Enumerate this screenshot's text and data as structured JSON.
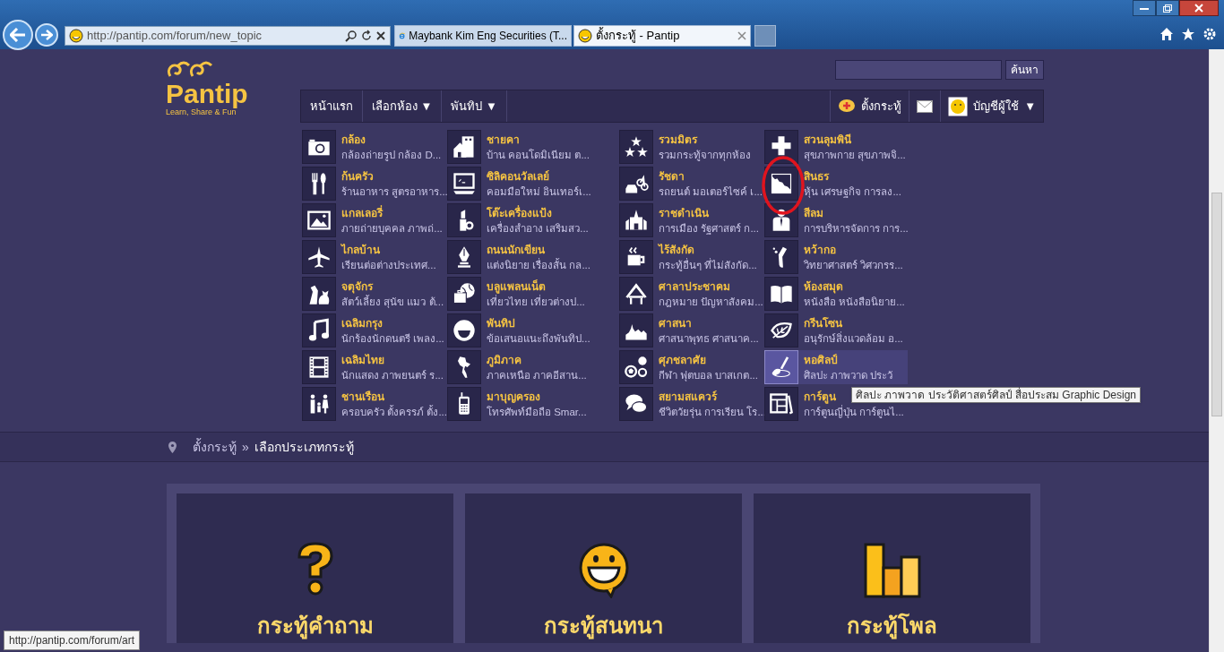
{
  "browser": {
    "address": "http://pantip.com/forum/new_topic",
    "tabs": [
      {
        "title": "Maybank Kim Eng Securities (T...",
        "selected": false,
        "kind": "ie"
      },
      {
        "title": "ตั้งกระทู้ - Pantip",
        "selected": true,
        "kind": "pantip"
      }
    ],
    "status_url": "http://pantip.com/forum/art"
  },
  "header": {
    "logo": "Pantip",
    "tagline": "Learn, Share & Fun",
    "search_button": "ค้นหา",
    "nav": [
      {
        "label": "หน้าแรก"
      },
      {
        "label": "เลือกห้อง",
        "caret": "▼"
      },
      {
        "label": "พันทิป",
        "caret": "▼"
      }
    ],
    "new_topic": "ตั้งกระทู้",
    "account": "บัญชีผู้ใช้",
    "account_caret": "▼"
  },
  "categories": [
    [
      {
        "title": "กล้อง",
        "description": "กล้องถ่ายรูป กล้อง D...",
        "highlighted": false
      },
      {
        "title": "ก้นครัว",
        "description": "ร้านอาหาร สูตรอาหาร...",
        "highlighted": false
      },
      {
        "title": "แกลเลอรี่",
        "description": "ภายถ่ายบุคคล ภาพถ่...",
        "highlighted": false
      },
      {
        "title": "ไกลบ้าน",
        "description": "เรียนต่อต่างประเทศ...",
        "highlighted": false
      },
      {
        "title": "จตุจักร",
        "description": "สัตว์เลี้ยง สุนัข แมว ต้...",
        "highlighted": false
      },
      {
        "title": "เฉลิมกรุง",
        "description": "นักร้องนักดนตรี เพลง...",
        "highlighted": false
      },
      {
        "title": "เฉลิมไทย",
        "description": "นักแสดง ภาพยนตร์ ร...",
        "highlighted": false
      },
      {
        "title": "ชานเรือน",
        "description": "ครอบครัว ตั้งครรภ์ ตั้ง...",
        "highlighted": false
      }
    ],
    [
      {
        "title": "ชายคา",
        "description": "บ้าน คอนโดมิเนียม ต...",
        "highlighted": false
      },
      {
        "title": "ซิลิคอนวัลเลย์",
        "description": "คอมมือใหม่ อินเทอร์เ...",
        "highlighted": false
      },
      {
        "title": "โต๊ะเครื่องแป้ง",
        "description": "เครื่องสำอาง เสริมสว...",
        "highlighted": false
      },
      {
        "title": "ถนนนักเขียน",
        "description": "แต่งนิยาย เรื่องสั้น กล...",
        "highlighted": false
      },
      {
        "title": "บลูแพลนเน็ต",
        "description": "เที่ยวไทย เที่ยวต่างป...",
        "highlighted": false
      },
      {
        "title": "พันทิป",
        "description": "ข้อเสนอแนะถึงพันทิป...",
        "highlighted": false
      },
      {
        "title": "ภูมิภาค",
        "description": "ภาคเหนือ ภาคอีสาน...",
        "highlighted": false
      },
      {
        "title": "มาบุญครอง",
        "description": "โทรศัพท์มือถือ Smar...",
        "highlighted": false
      }
    ],
    [
      {
        "title": "รวมมิตร",
        "description": "รวมกระทู้จากทุกห้อง",
        "highlighted": false
      },
      {
        "title": "รัชดา",
        "description": "รถยนต์ มอเตอร์ไซค์ เ...",
        "highlighted": false
      },
      {
        "title": "ราชดำเนิน",
        "description": "การเมือง รัฐศาสตร์ ก...",
        "highlighted": false
      },
      {
        "title": "ไร้สังกัด",
        "description": "กระทู้อื่นๆ ที่ไม่สังกัด...",
        "highlighted": false
      },
      {
        "title": "ศาลาประชาคม",
        "description": "กฎหมาย ปัญหาสังคม...",
        "highlighted": false
      },
      {
        "title": "ศาสนา",
        "description": "ศาสนาพุทธ ศาสนาค...",
        "highlighted": false
      },
      {
        "title": "ศุภชลาศัย",
        "description": "กีฬา ฟุตบอล บาสเกต...",
        "highlighted": false
      },
      {
        "title": "สยามสแควร์",
        "description": "ชีวิตวัยรุ่น การเรียน โร...",
        "highlighted": false
      }
    ],
    [
      {
        "title": "สวนลุมพินี",
        "description": "สุขภาพกาย สุขภาพจิ...",
        "highlighted": false
      },
      {
        "title": "สินธร",
        "description": "หุ้น เศรษฐกิจ การลง...",
        "highlighted": false
      },
      {
        "title": "สีลม",
        "description": "การบริหารจัดการ การ...",
        "highlighted": false
      },
      {
        "title": "หว้ากอ",
        "description": "วิทยาศาสตร์ วิศวกรร...",
        "highlighted": false
      },
      {
        "title": "ห้องสมุด",
        "description": "หนังสือ หนังสือนิยาย...",
        "highlighted": false
      },
      {
        "title": "กรีนโซน",
        "description": "อนุรักษ์สิ่งแวดล้อม อ...",
        "highlighted": false
      },
      {
        "title": "หอศิลป์",
        "description": "ศิลปะ ภาพวาด ประวั",
        "highlighted": true
      },
      {
        "title": "การ์ตูน",
        "description": "การ์ตูนญี่ปุ่น การ์ตูนไ...",
        "highlighted": false
      }
    ]
  ],
  "tooltip": "ศิลปะ ภาพวาด ประวัติศาสตร์ศิลป์ สื่อประสม Graphic Design",
  "breadcrumb": {
    "items": [
      "ตั้งกระทู้",
      "เลือกประเภทกระทู้"
    ],
    "separator": "»"
  },
  "cards": [
    {
      "title": "กระทู้คำถาม",
      "kind": "question"
    },
    {
      "title": "กระทู้สนทนา",
      "kind": "chat"
    },
    {
      "title": "กระทู้โพล",
      "kind": "poll"
    }
  ]
}
